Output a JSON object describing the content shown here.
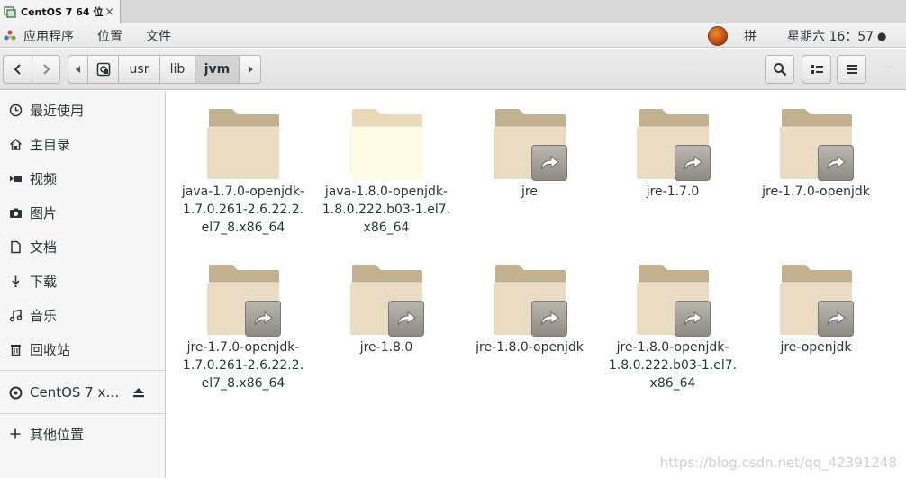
{
  "vm_tab": {
    "title": "CentOS 7 64 位",
    "close": "×"
  },
  "top_panel": {
    "apps_menu": "应用程序",
    "places_menu": "位置",
    "file_menu": "文件",
    "input_method": "拼",
    "clock": "星期六 16：57",
    "status_dot": "●"
  },
  "toolbar": {
    "breadcrumb": [
      "usr",
      "lib",
      "jvm"
    ]
  },
  "sidebar": {
    "items": [
      {
        "label": "最近使用",
        "icon": "clock-icon"
      },
      {
        "label": "主目录",
        "icon": "home-icon"
      },
      {
        "label": "视频",
        "icon": "video-icon"
      },
      {
        "label": "图片",
        "icon": "camera-icon"
      },
      {
        "label": "文档",
        "icon": "document-icon"
      },
      {
        "label": "下载",
        "icon": "download-icon"
      },
      {
        "label": "音乐",
        "icon": "music-icon"
      },
      {
        "label": "回收站",
        "icon": "trash-icon"
      }
    ],
    "device": {
      "label": "CentOS 7 x…",
      "icon": "disc-icon"
    },
    "other": {
      "label": "其他位置",
      "icon": "plus-icon"
    }
  },
  "files": [
    {
      "lines": [
        "java-1.7.0-openjdk-",
        "1.7.0.261-2.6.22.2.",
        "el7_8.x86_64"
      ],
      "link": false,
      "highlight": false
    },
    {
      "lines": [
        "java-1.8.0-openjdk-",
        "1.8.0.222.b03-1.el7.",
        "x86_64"
      ],
      "link": false,
      "highlight": true
    },
    {
      "lines": [
        "jre"
      ],
      "link": true,
      "highlight": false
    },
    {
      "lines": [
        "jre-1.7.0"
      ],
      "link": true,
      "highlight": false
    },
    {
      "lines": [
        "jre-1.7.0-openjdk"
      ],
      "link": true,
      "highlight": false
    },
    {
      "lines": [
        "jre-1.7.0-openjdk-",
        "1.7.0.261-2.6.22.2.",
        "el7_8.x86_64"
      ],
      "link": true,
      "highlight": false
    },
    {
      "lines": [
        "jre-1.8.0"
      ],
      "link": true,
      "highlight": false
    },
    {
      "lines": [
        "jre-1.8.0-openjdk"
      ],
      "link": true,
      "highlight": false
    },
    {
      "lines": [
        "jre-1.8.0-openjdk-",
        "1.8.0.222.b03-1.el7.",
        "x86_64"
      ],
      "link": true,
      "highlight": false
    },
    {
      "lines": [
        "jre-openjdk"
      ],
      "link": true,
      "highlight": false
    }
  ],
  "watermark": "https://blog.csdn.net/qq_42391248",
  "colors": {
    "folder_back": "#c1b190",
    "folder_front": "#e9dcc3",
    "folder_front_highlight": "#fdfbe3",
    "folder_back_highlight": "#e8dab8"
  }
}
